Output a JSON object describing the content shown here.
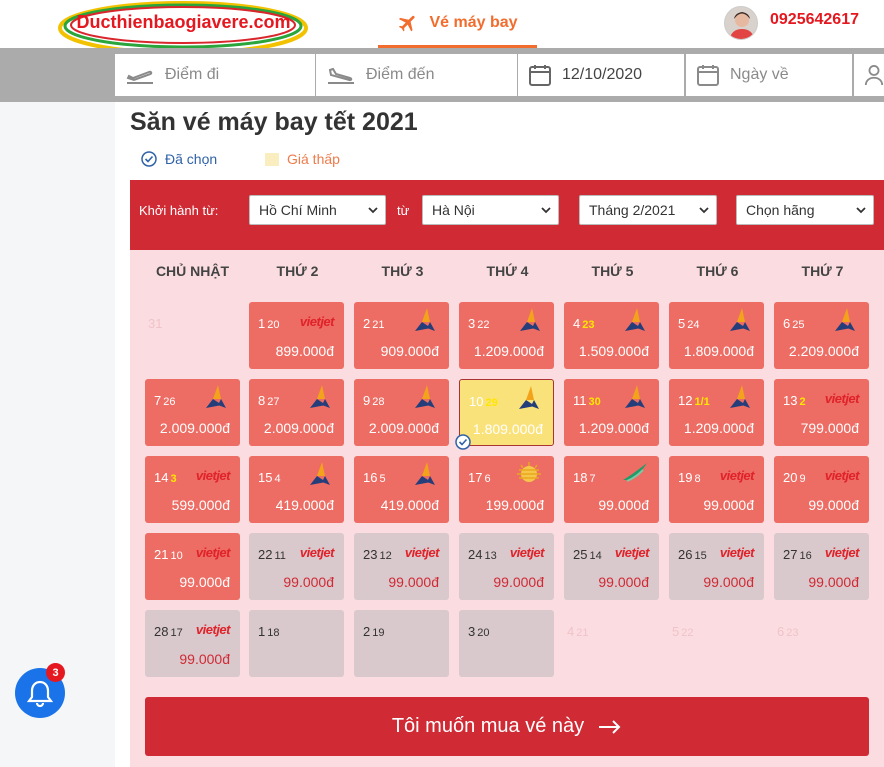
{
  "header": {
    "logo_text": "Ducthienbaogiavere.com",
    "nav_tab_label": "Vé máy bay",
    "phone": "0925642617"
  },
  "search": {
    "from_placeholder": "Điểm đi",
    "to_placeholder": "Điểm đến",
    "depart_date": "12/10/2020",
    "return_placeholder": "Ngày về"
  },
  "page_title": "Săn vé máy bay tết 2021",
  "legend": {
    "selected": "Đã chọn",
    "cheap": "Giá thấp"
  },
  "filters": {
    "from_label": "Khởi hành từ:",
    "from_value": "Hồ Chí Minh",
    "to_label": "từ",
    "to_value": "Hà Nội",
    "month_value": "Tháng 2/2021",
    "airline_value": "Chọn hãng"
  },
  "weekdays": [
    "CHỦ NHẬT",
    "THỨ 2",
    "THỨ 3",
    "THỨ 4",
    "THỨ 5",
    "THỨ 6",
    "THỨ 7"
  ],
  "calendar": {
    "rows": [
      [
        {
          "day": "31",
          "lunar": "",
          "price": "",
          "airline": "",
          "state": "empty"
        },
        {
          "day": "1",
          "lunar": "20",
          "price": "899.000đ",
          "airline": "vietjet",
          "state": "active"
        },
        {
          "day": "2",
          "lunar": "21",
          "price": "909.000đ",
          "airline": "vietnam-airlines",
          "state": "active"
        },
        {
          "day": "3",
          "lunar": "22",
          "price": "1.209.000đ",
          "airline": "vietnam-airlines",
          "state": "active"
        },
        {
          "day": "4",
          "lunar": "23",
          "price": "1.509.000đ",
          "airline": "vietnam-airlines",
          "state": "active",
          "hl": true
        },
        {
          "day": "5",
          "lunar": "24",
          "price": "1.809.000đ",
          "airline": "vietnam-airlines",
          "state": "active"
        },
        {
          "day": "6",
          "lunar": "25",
          "price": "2.209.000đ",
          "airline": "vietnam-airlines",
          "state": "active"
        }
      ],
      [
        {
          "day": "7",
          "lunar": "26",
          "price": "2.009.000đ",
          "airline": "vietnam-airlines",
          "state": "active"
        },
        {
          "day": "8",
          "lunar": "27",
          "price": "2.009.000đ",
          "airline": "vietnam-airlines",
          "state": "active"
        },
        {
          "day": "9",
          "lunar": "28",
          "price": "2.009.000đ",
          "airline": "vietnam-airlines",
          "state": "active"
        },
        {
          "day": "10",
          "lunar": "29",
          "price": "1.809.000đ",
          "airline": "vietnam-airlines",
          "state": "selected",
          "hl": true
        },
        {
          "day": "11",
          "lunar": "30",
          "price": "1.209.000đ",
          "airline": "vietnam-airlines",
          "state": "active",
          "hl": true
        },
        {
          "day": "12",
          "lunar": "1/1",
          "price": "1.209.000đ",
          "airline": "vietnam-airlines",
          "state": "active",
          "hl": true
        },
        {
          "day": "13",
          "lunar": "2",
          "price": "799.000đ",
          "airline": "vietjet",
          "state": "active",
          "hl": true
        }
      ],
      [
        {
          "day": "14",
          "lunar": "3",
          "price": "599.000đ",
          "airline": "vietjet",
          "state": "active",
          "hl": true
        },
        {
          "day": "15",
          "lunar": "4",
          "price": "419.000đ",
          "airline": "vietnam-airlines",
          "state": "active"
        },
        {
          "day": "16",
          "lunar": "5",
          "price": "419.000đ",
          "airline": "vietnam-airlines",
          "state": "active"
        },
        {
          "day": "17",
          "lunar": "6",
          "price": "199.000đ",
          "airline": "vietravel",
          "state": "active"
        },
        {
          "day": "18",
          "lunar": "7",
          "price": "99.000đ",
          "airline": "bamboo",
          "state": "active"
        },
        {
          "day": "19",
          "lunar": "8",
          "price": "99.000đ",
          "airline": "vietjet",
          "state": "active"
        },
        {
          "day": "20",
          "lunar": "9",
          "price": "99.000đ",
          "airline": "vietjet",
          "state": "active"
        }
      ],
      [
        {
          "day": "21",
          "lunar": "10",
          "price": "99.000đ",
          "airline": "vietjet",
          "state": "active"
        },
        {
          "day": "22",
          "lunar": "11",
          "price": "99.000đ",
          "airline": "vietjet",
          "state": "grey"
        },
        {
          "day": "23",
          "lunar": "12",
          "price": "99.000đ",
          "airline": "vietjet",
          "state": "grey"
        },
        {
          "day": "24",
          "lunar": "13",
          "price": "99.000đ",
          "airline": "vietjet",
          "state": "grey"
        },
        {
          "day": "25",
          "lunar": "14",
          "price": "99.000đ",
          "airline": "vietjet",
          "state": "grey"
        },
        {
          "day": "26",
          "lunar": "15",
          "price": "99.000đ",
          "airline": "vietjet",
          "state": "grey"
        },
        {
          "day": "27",
          "lunar": "16",
          "price": "99.000đ",
          "airline": "vietjet",
          "state": "grey"
        }
      ],
      [
        {
          "day": "28",
          "lunar": "17",
          "price": "99.000đ",
          "airline": "vietjet",
          "state": "grey"
        },
        {
          "day": "1",
          "lunar": "18",
          "price": "",
          "airline": "",
          "state": "grey"
        },
        {
          "day": "2",
          "lunar": "19",
          "price": "",
          "airline": "",
          "state": "grey"
        },
        {
          "day": "3",
          "lunar": "20",
          "price": "",
          "airline": "",
          "state": "grey"
        },
        {
          "day": "4",
          "lunar": "21",
          "price": "",
          "airline": "",
          "state": "empty"
        },
        {
          "day": "5",
          "lunar": "22",
          "price": "",
          "airline": "",
          "state": "empty"
        },
        {
          "day": "6",
          "lunar": "23",
          "price": "",
          "airline": "",
          "state": "empty"
        }
      ]
    ]
  },
  "vietjet_logo_text": "vietjet",
  "buy_button": "Tôi muốn mua vé này",
  "notifications": {
    "count": "3"
  },
  "colors": {
    "brand_red": "#d02a35",
    "accent_orange": "#f26c2e",
    "cell_red": "#ed6c63",
    "selected_yellow": "#fae27a"
  }
}
